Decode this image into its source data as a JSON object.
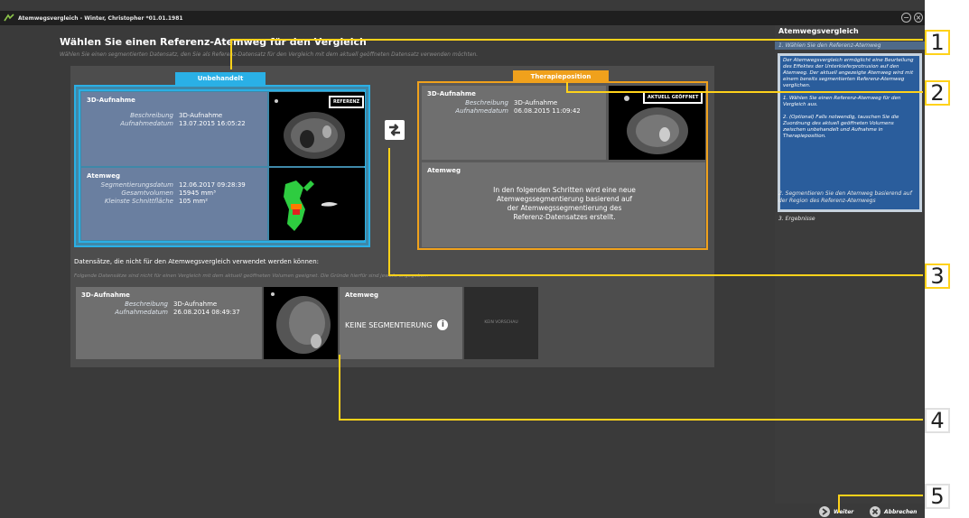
{
  "window": {
    "title": "Atemwegsvergleich - Winter, Christopher *01.01.1981"
  },
  "page": {
    "title": "Wählen Sie einen Referenz-Atemweg für den Vergleich",
    "subtitle": "Wählen Sie einen segmentierten Datensatz, den Sie als Referenz-Datensatz für den Vergleich mit dem aktuell geöffneten Datensatz verwenden möchten."
  },
  "untreated": {
    "tab": "Unbehandelt",
    "scan": {
      "heading": "3D-Aufnahme",
      "desc_label": "Beschreibung",
      "desc_value": "3D-Aufnahme",
      "date_label": "Aufnahmedatum",
      "date_value": "13.07.2015 16:05:22",
      "badge": "REFERENZ"
    },
    "airway": {
      "heading": "Atemweg",
      "seg_date_label": "Segmentierungsdatum",
      "seg_date_value": "12.06.2017 09:28:39",
      "volume_label": "Gesamtvolumen",
      "volume_value": "15945 mm³",
      "area_label": "Kleinste Schnittfläche",
      "area_value": "105 mm²"
    }
  },
  "therapy": {
    "tab": "Therapieposition",
    "scan": {
      "heading": "3D-Aufnahme",
      "desc_label": "Beschreibung",
      "desc_value": "3D-Aufnahme",
      "date_label": "Aufnahmedatum",
      "date_value": "06.08.2015 11:09:42",
      "badge": "AKTUELL GEÖFFNET"
    },
    "airway": {
      "heading": "Atemweg",
      "message": "In den folgenden Schritten wird eine neue Atemwegssegmentierung basierend auf der Atemwegssegmentierung des Referenz-Datensatzes erstellt."
    }
  },
  "excluded": {
    "title": "Datensätze, die nicht für den Atemwegsvergleich verwendet werden können:",
    "subtitle": "Folgende Datensätze sind nicht für einen Vergleich mit dem aktuell geöffneten Volumen geeignet. Die Gründe hierfür sind jeweils angegeben.",
    "scan": {
      "heading": "3D-Aufnahme",
      "desc_label": "Beschreibung",
      "desc_value": "3D-Aufnahme",
      "date_label": "Aufnahmedatum",
      "date_value": "26.08.2014 08:49:37"
    },
    "airway": {
      "heading": "Atemweg",
      "status": "KEINE SEGMENTIERUNG",
      "no_preview": "KEIN VORSCHAU"
    }
  },
  "sidebar": {
    "title": "Atemwegsvergleich",
    "step1": "1. Wählen Sie den Referenz-Atemweg",
    "desc_p1": "Der Atemwegsvergleich ermöglicht eine Beurteilung des Effektes der Unterkieferprotrusion auf den Atemweg. Der aktuell angezeigte Atemweg wird mit einem bereits segmentierten Referenz-Atemweg verglichen.",
    "desc_p2": "1. Wählen Sie einen Referenz-Atemweg für den Vergleich aus.",
    "desc_p3": "2. (Optional) Falls notwendig, tauschen Sie die Zuordnung des aktuell geöffneten Volumens zwischen unbehandelt und Aufnahme in Therapieposition.",
    "step2": "2. Segmentieren Sie den Atemweg basierend auf der Region des Referenz-Atemwegs",
    "step3": "3. Ergebnisse"
  },
  "footer": {
    "next": "Weiter",
    "cancel": "Abbrechen"
  },
  "callouts": [
    "1",
    "2",
    "3",
    "4",
    "5"
  ],
  "colors": {
    "untreated_accent": "#2ab0e6",
    "therapy_accent": "#f0a11c",
    "callout": "#ffd21a",
    "step_desc_bg": "#2a5d9c"
  }
}
